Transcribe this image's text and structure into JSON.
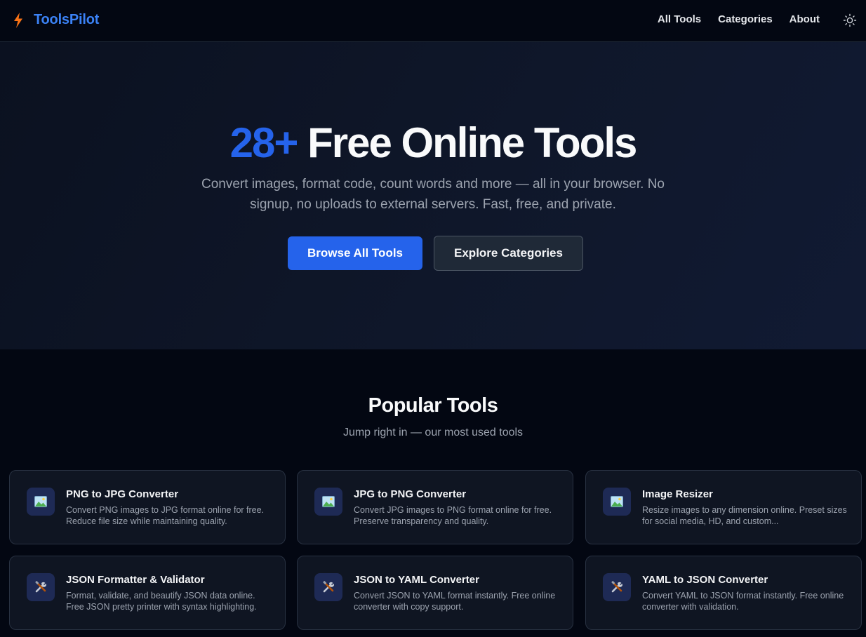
{
  "header": {
    "logo_text": "ToolsPilot",
    "logo_icon": "lightning-bolt-icon",
    "nav": [
      {
        "label": "All Tools"
      },
      {
        "label": "Categories"
      },
      {
        "label": "About"
      }
    ],
    "theme_icon": "sun-icon"
  },
  "hero": {
    "title_accent": "28+",
    "title_rest": " Free Online Tools",
    "subtitle": "Convert images, format code, count words and more — all in your browser. No signup, no uploads to external servers. Fast, free, and private.",
    "primary_button": "Browse All Tools",
    "secondary_button": "Explore Categories"
  },
  "popular": {
    "title": "Popular Tools",
    "subtitle": "Jump right in — our most used tools",
    "cards": [
      {
        "icon": "image-icon",
        "title": "PNG to JPG Converter",
        "desc": "Convert PNG images to JPG format online for free. Reduce file size while maintaining quality."
      },
      {
        "icon": "image-icon",
        "title": "JPG to PNG Converter",
        "desc": "Convert JPG images to PNG format online for free. Preserve transparency and quality."
      },
      {
        "icon": "image-icon",
        "title": "Image Resizer",
        "desc": "Resize images to any dimension online. Preset sizes for social media, HD, and custom..."
      },
      {
        "icon": "tools-icon",
        "title": "JSON Formatter & Validator",
        "desc": "Format, validate, and beautify JSON data online. Free JSON pretty printer with syntax highlighting."
      },
      {
        "icon": "tools-icon",
        "title": "JSON to YAML Converter",
        "desc": "Convert JSON to YAML format instantly. Free online converter with copy support."
      },
      {
        "icon": "tools-icon",
        "title": "YAML to JSON Converter",
        "desc": "Convert YAML to JSON format instantly. Free online converter with validation."
      }
    ]
  },
  "colors": {
    "background": "#030712",
    "accent": "#2563eb",
    "card_background": "#0f1522",
    "muted_text": "#9ca3af"
  }
}
